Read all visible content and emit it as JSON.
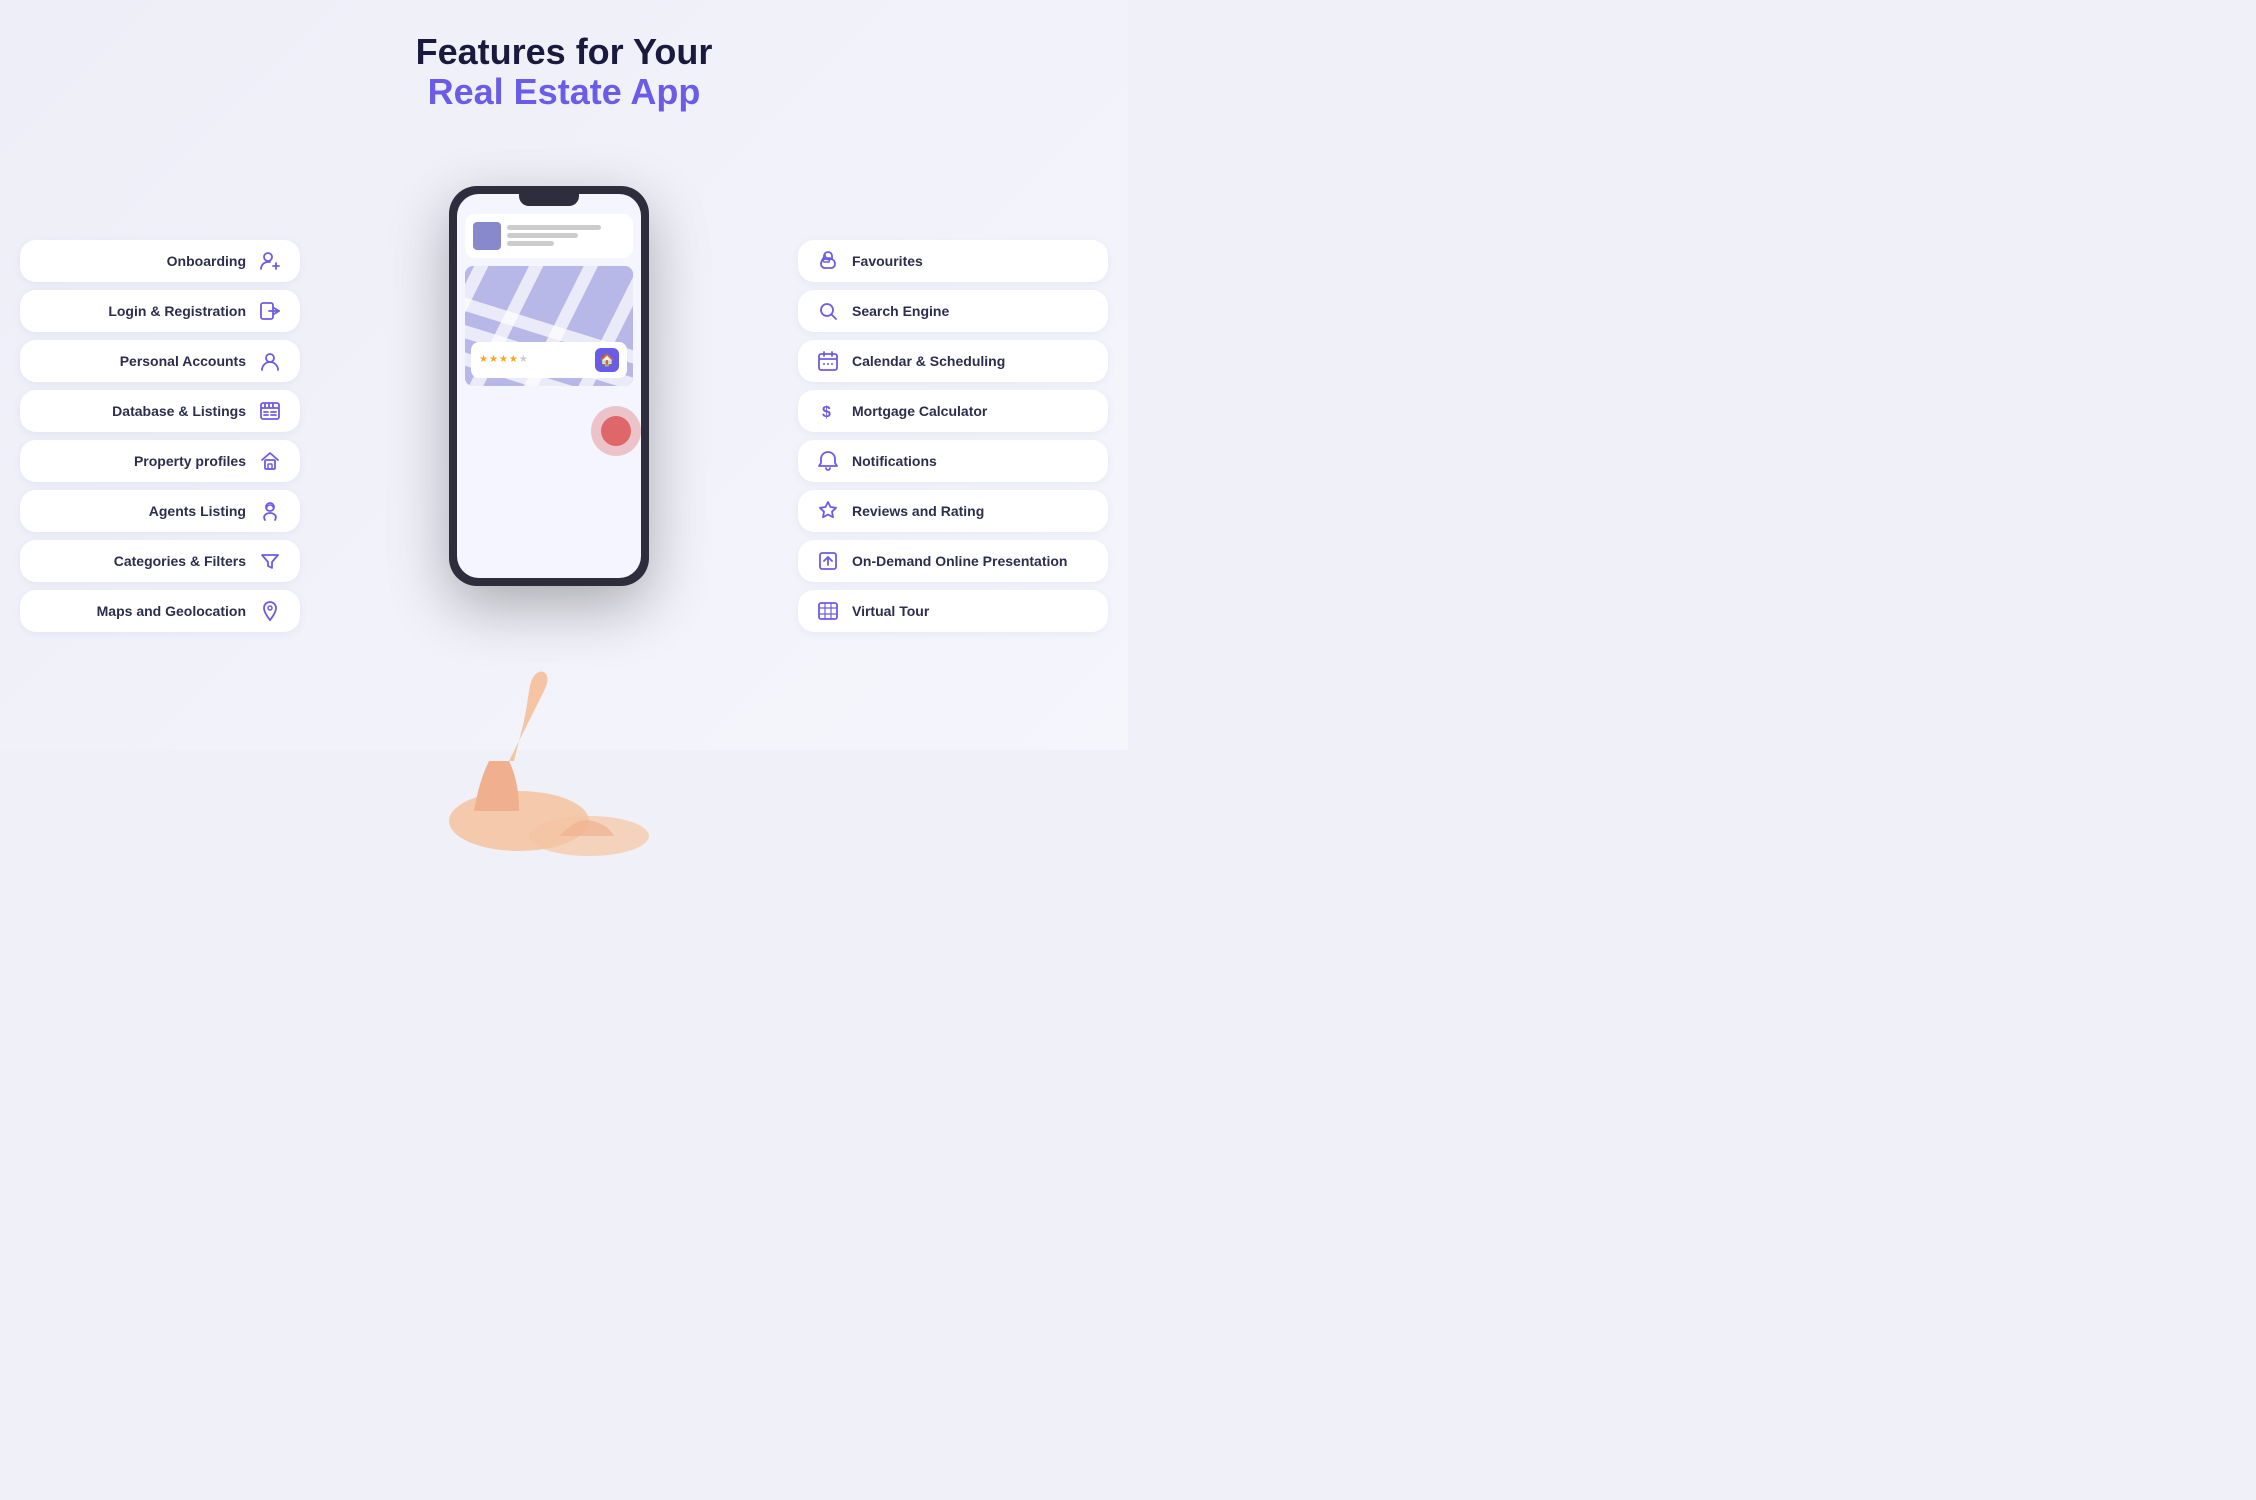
{
  "header": {
    "line1": "Features for Your",
    "line2": "Real Estate App"
  },
  "left_features": [
    {
      "label": "Onboarding",
      "icon": "👤+",
      "icon_unicode": "🙂"
    },
    {
      "label": "Login & Registration",
      "icon": "➡"
    },
    {
      "label": "Personal Accounts",
      "icon": "👤"
    },
    {
      "label": "Database & Listings",
      "icon": "🗃"
    },
    {
      "label": "Property profiles",
      "icon": "🏠"
    },
    {
      "label": "Agents Listing",
      "icon": "🎧"
    },
    {
      "label": "Categories & Filters",
      "icon": "⬇"
    },
    {
      "label": "Maps and Geolocation",
      "icon": "📍"
    }
  ],
  "right_features": [
    {
      "label": "Favourites",
      "icon": "👍"
    },
    {
      "label": "Search Engine",
      "icon": "🔍"
    },
    {
      "label": "Calendar & Scheduling",
      "icon": "📅"
    },
    {
      "label": "Mortgage Calculator",
      "icon": "$"
    },
    {
      "label": "Notifications",
      "icon": "🔔"
    },
    {
      "label": "Reviews and Rating",
      "icon": "⭐"
    },
    {
      "label": "On-Demand Online Presentation",
      "icon": "⬆"
    },
    {
      "label": "Virtual Tour",
      "icon": "🏢"
    }
  ]
}
